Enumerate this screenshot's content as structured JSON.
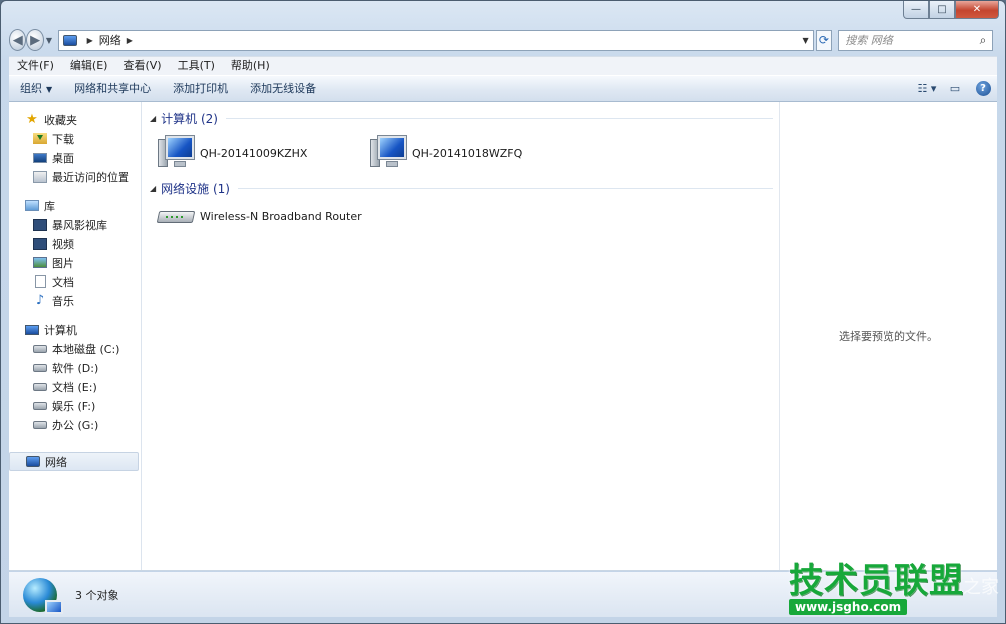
{
  "window": {
    "caption_buttons": {
      "minimize": "—",
      "maximize": "□",
      "close": "✕"
    }
  },
  "address_bar": {
    "crumbs": [
      "网络"
    ],
    "search_placeholder": "搜索 网络"
  },
  "menubar": {
    "items": [
      "文件(F)",
      "编辑(E)",
      "查看(V)",
      "工具(T)",
      "帮助(H)"
    ]
  },
  "toolbar": {
    "organize": "组织",
    "items": [
      "网络和共享中心",
      "添加打印机",
      "添加无线设备"
    ]
  },
  "nav_pane": {
    "favorites": {
      "label": "收藏夹",
      "items": [
        "下载",
        "桌面",
        "最近访问的位置"
      ]
    },
    "libraries": {
      "label": "库",
      "items": [
        "暴风影视库",
        "视频",
        "图片",
        "文档",
        "音乐"
      ]
    },
    "computer": {
      "label": "计算机",
      "items": [
        "本地磁盘 (C:)",
        "软件 (D:)",
        "文档 (E:)",
        "娱乐 (F:)",
        "办公 (G:)"
      ]
    },
    "network": {
      "label": "网络"
    }
  },
  "main": {
    "groups": [
      {
        "header": "计算机 (2)",
        "items": [
          "QH-20141009KZHX",
          "QH-20141018WZFQ"
        ]
      },
      {
        "header": "网络设施 (1)",
        "items": [
          "Wireless-N Broadband Router"
        ]
      }
    ]
  },
  "preview_pane": {
    "text": "选择要预览的文件。"
  },
  "status_bar": {
    "text": "3 个对象"
  },
  "watermark": {
    "brand": "技术员联盟",
    "url": "www.jsgho.com",
    "side": "之家"
  },
  "colors": {
    "accent": "#1e3287",
    "brand_green": "#17a83a",
    "close_red": "#c4452f"
  }
}
